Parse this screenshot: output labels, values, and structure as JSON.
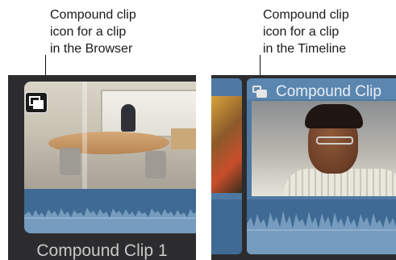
{
  "callouts": {
    "browser": {
      "line1": "Compound clip",
      "line2": "icon for a clip",
      "line3": "in the Browser"
    },
    "timeline": {
      "line1": "Compound clip",
      "line2": "icon for a clip",
      "line3": "in the Timeline"
    }
  },
  "browser": {
    "clip_name": "Compound Clip 1",
    "icon": "compound-clip-icon"
  },
  "timeline": {
    "clip_name": "Compound Clip",
    "icon": "compound-clip-icon"
  },
  "colors": {
    "panel_background": "#2c2c2e",
    "clip_blue": "#4f79a3",
    "audio_blue": "#3f6a93"
  }
}
